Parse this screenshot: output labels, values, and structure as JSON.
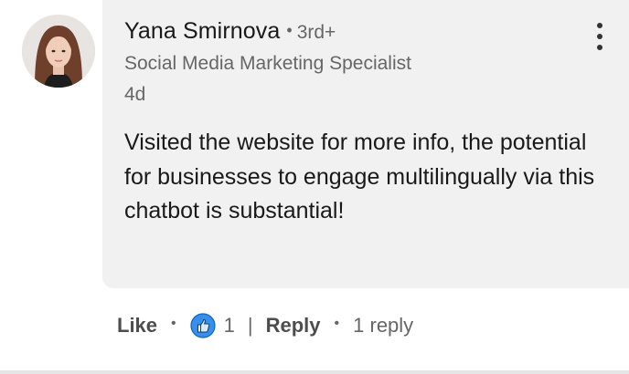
{
  "comment": {
    "author": {
      "name": "Yana Smirnova",
      "connection_separator": "•",
      "connection_degree": "3rd+",
      "headline": "Social Media Marketing Specialist"
    },
    "timestamp": "4d",
    "text": "Visited the website for more info, the potential for businesses to engage multilingually via this chatbot is substantial!",
    "more_icon": "three-dots-vertical-icon"
  },
  "actions": {
    "like_label": "Like",
    "dot_separator": "•",
    "reaction_icon": "thumbs-up-icon",
    "reaction_count": "1",
    "pipe_separator": "|",
    "reply_label": "Reply",
    "replies_count": "1 reply"
  },
  "colors": {
    "bubble_background": "#f1f1f1",
    "primary_text": "#191919",
    "secondary_text": "#666666",
    "action_text": "#4d4d4d",
    "reaction_blue": "#378fe9"
  }
}
